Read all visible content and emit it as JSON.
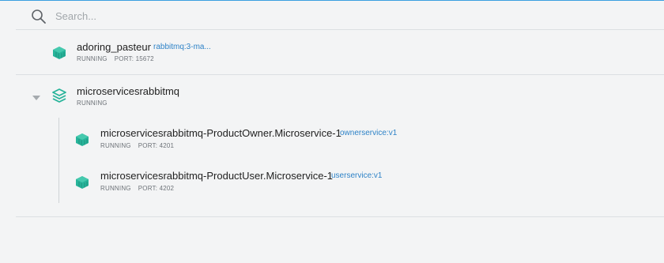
{
  "search": {
    "placeholder": "Search..."
  },
  "containers": [
    {
      "name": "adoring_pasteur",
      "image": "rabbitmq:3-ma...",
      "status": "RUNNING",
      "port": "PORT: 15672"
    }
  ],
  "group": {
    "name": "microservicesrabbitmq",
    "status": "RUNNING",
    "children": [
      {
        "name": "microservicesrabbitmq-ProductOwner.Microservice-1",
        "image": "ownerservice:v1",
        "status": "RUNNING",
        "port": "PORT: 4201"
      },
      {
        "name": "microservicesrabbitmq-ProductUser.Microservice-1",
        "image": "userservice:v1",
        "status": "RUNNING",
        "port": "PORT: 4202"
      }
    ]
  },
  "colors": {
    "accent_border": "#3a9fe0",
    "icon_teal": "#27b49a",
    "link_blue": "#2d82c7"
  },
  "icons": {
    "search": "search-icon",
    "container": "container-cube-icon",
    "stack": "stack-layers-icon",
    "caret": "caret-down-icon"
  }
}
